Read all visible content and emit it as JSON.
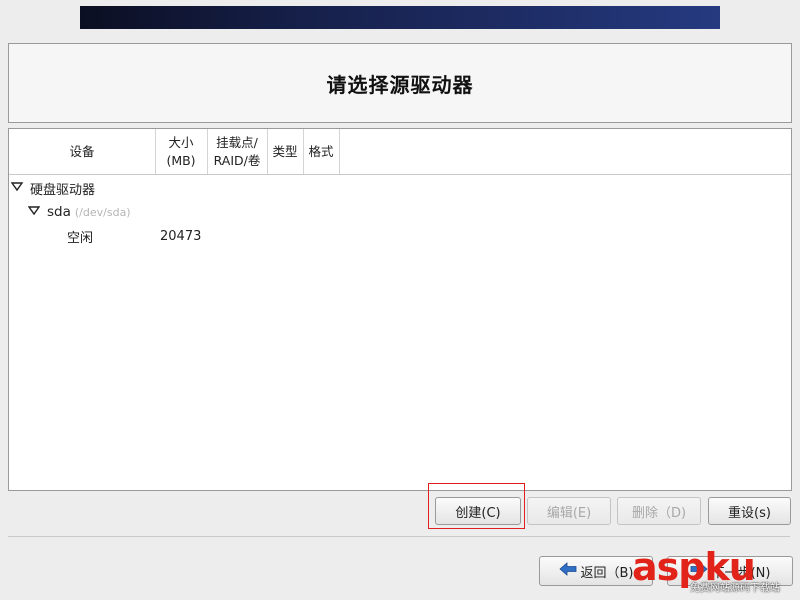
{
  "title": "请选择源驱动器",
  "table": {
    "headers": {
      "device": "设备",
      "size_line1": "大小",
      "size_line2": "(MB)",
      "mount_line1": "挂载点/",
      "mount_line2": "RAID/卷",
      "type": "类型",
      "format": "格式"
    },
    "rows": {
      "hard_drives": "硬盘驱动器",
      "sda_name": "sda",
      "sda_path": "(/dev/sda)",
      "free_label": "空闲",
      "free_size": "20473"
    }
  },
  "buttons": {
    "create": "创建(C)",
    "edit": "编辑(E)",
    "delete": "删除（D)",
    "reset": "重设(s)",
    "back": "返回（B)",
    "next": "下一步(N)"
  },
  "watermark": {
    "brand": "aspku",
    "tagline": "免费网站源码下载站"
  },
  "colors": {
    "highlight": "#e02020",
    "banner": "#16204a",
    "watermark": "#e2231a"
  }
}
